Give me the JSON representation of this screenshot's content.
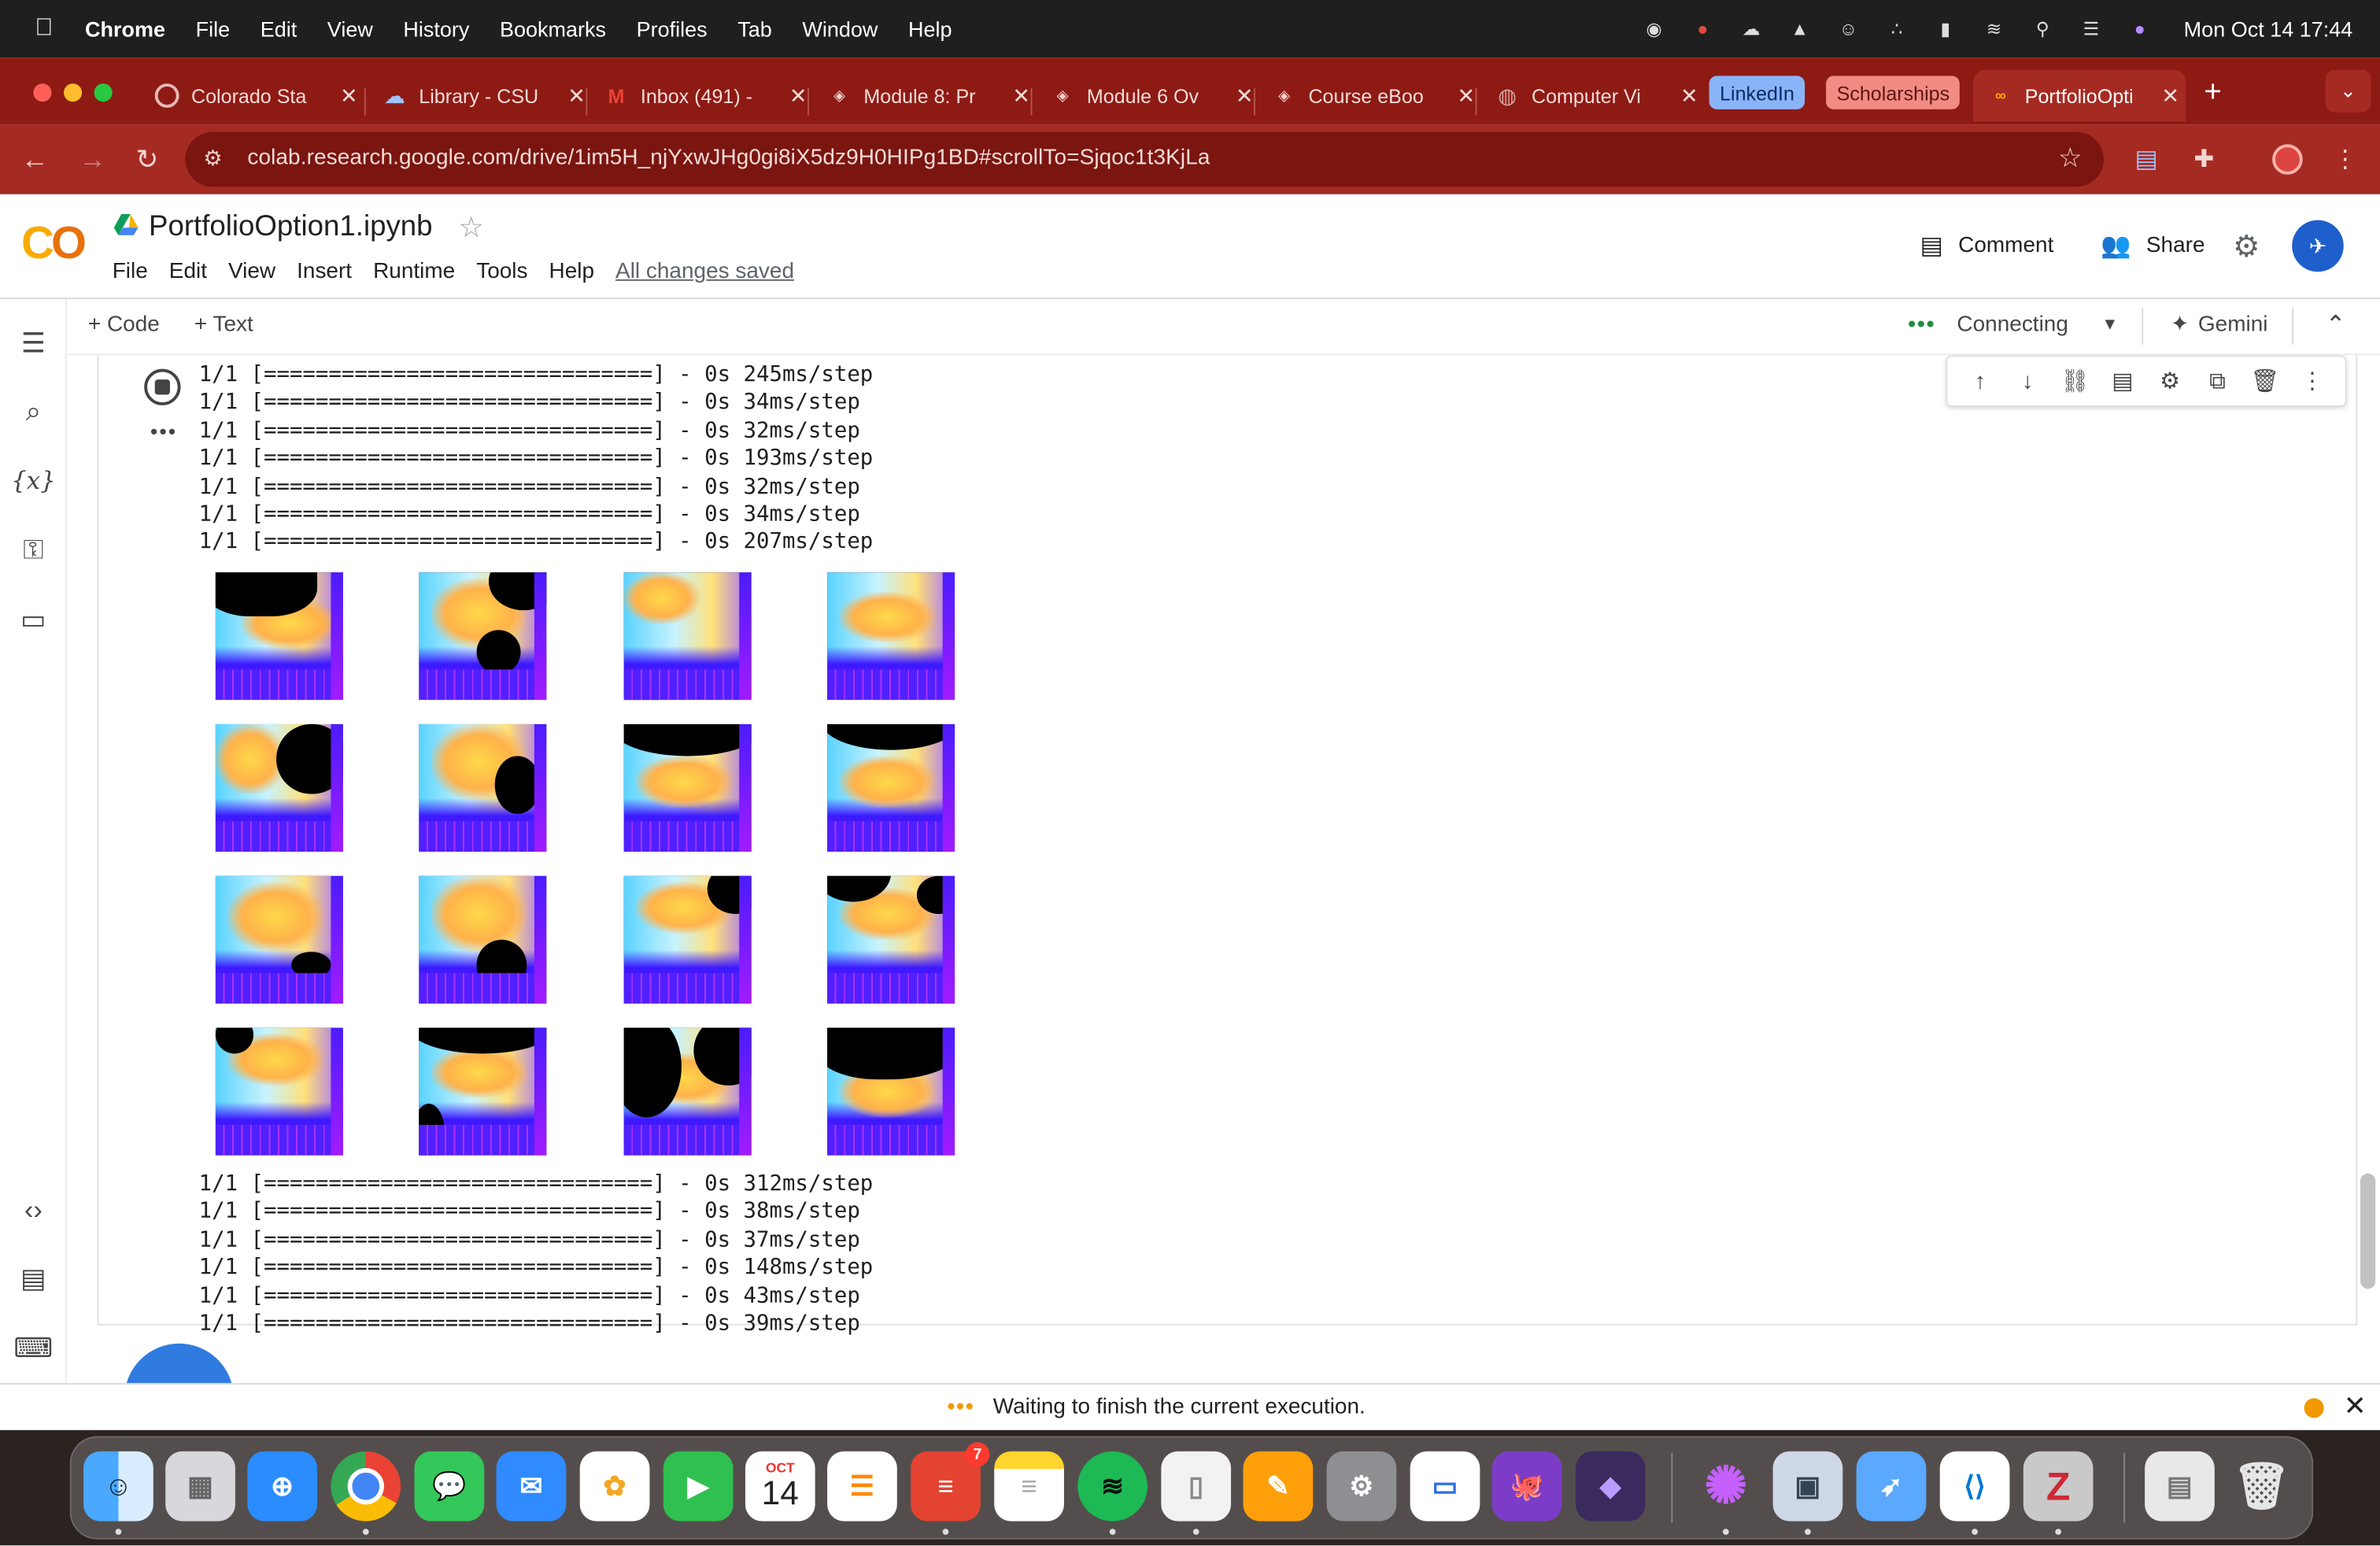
{
  "menubar": {
    "app": "Chrome",
    "items": [
      "File",
      "Edit",
      "View",
      "History",
      "Bookmarks",
      "Profiles",
      "Tab",
      "Window",
      "Help"
    ],
    "datetime": "Mon Oct 14  17:44"
  },
  "tabs": [
    {
      "title": "Colorado Sta"
    },
    {
      "title": "Library - CSU"
    },
    {
      "title": "Inbox (491) -"
    },
    {
      "title": "Module 8: Pr"
    },
    {
      "title": "Module 6 Ov"
    },
    {
      "title": "Course eBoo"
    },
    {
      "title": "Computer Vi"
    },
    {
      "title": "PortfolioOpti"
    }
  ],
  "tab_groups": {
    "linkedin": "LinkedIn",
    "scholarships": "Scholarships"
  },
  "address": {
    "url": "colab.research.google.com/drive/1im5H_njYxwJHg0gi8iX5dz9H0HIPg1BD#scrollTo=Sjqoc1t3KjLa"
  },
  "colab": {
    "notebook_title": "PortfolioOption1.ipynb",
    "menu": [
      "File",
      "Edit",
      "View",
      "Insert",
      "Runtime",
      "Tools",
      "Help"
    ],
    "saved_status": "All changes saved",
    "comment_label": "Comment",
    "share_label": "Share",
    "add_code": "+ Code",
    "add_text": "+ Text",
    "connection": "Connecting",
    "gemini": "Gemini"
  },
  "output": {
    "lines_top": [
      "1/1 [==============================] - 0s 245ms/step",
      "1/1 [==============================] - 0s 34ms/step",
      "1/1 [==============================] - 0s 32ms/step",
      "1/1 [==============================] - 0s 193ms/step",
      "1/1 [==============================] - 0s 32ms/step",
      "1/1 [==============================] - 0s 34ms/step",
      "1/1 [==============================] - 0s 207ms/step"
    ],
    "lines_bottom": [
      "1/1 [==============================] - 0s 312ms/step",
      "1/1 [==============================] - 0s 38ms/step",
      "1/1 [==============================] - 0s 37ms/step",
      "1/1 [==============================] - 0s 148ms/step",
      "1/1 [==============================] - 0s 43ms/step",
      "1/1 [==============================] - 0s 39ms/step"
    ]
  },
  "status": {
    "message": "Waiting to finish the current execution."
  },
  "dock": {
    "calendar_month": "OCT",
    "calendar_day": "14",
    "todoist_badge": "7"
  }
}
